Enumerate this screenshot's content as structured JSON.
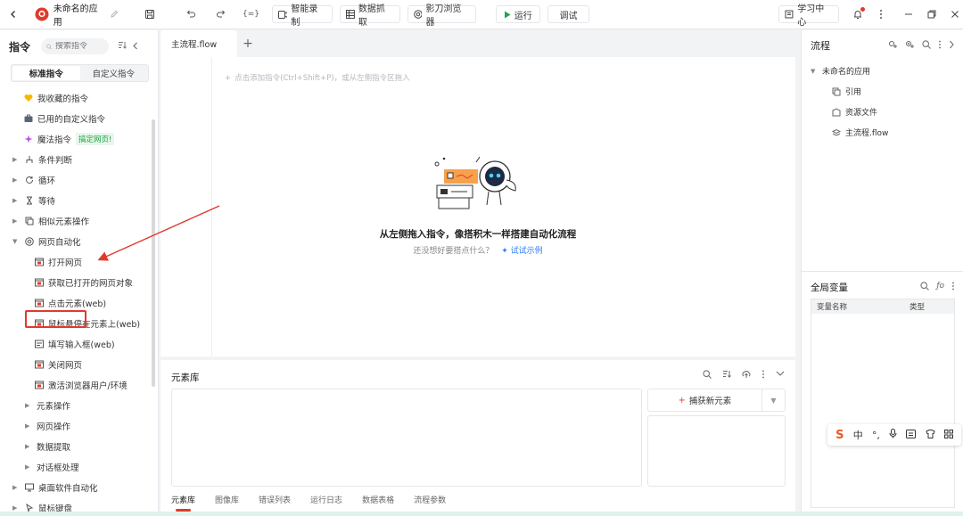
{
  "topbar": {
    "app_name": "未命名的应用",
    "buttons": {
      "variable": "{=}",
      "smart_record": "智能录制",
      "data_capture": "数据抓取",
      "browser": "影刀浏览器",
      "run": "运行",
      "debug": "调试",
      "learning_center": "学习中心"
    }
  },
  "left_panel": {
    "title": "指令",
    "search_placeholder": "搜索指令",
    "tabs": [
      "标准指令",
      "自定义指令"
    ],
    "favorites": "我收藏的指令",
    "used_custom": "已用的自定义指令",
    "magic": "魔法指令",
    "magic_badge": "搞定网页!",
    "items": [
      {
        "label": "条件判断"
      },
      {
        "label": "循环"
      },
      {
        "label": "等待"
      },
      {
        "label": "相似元素操作"
      },
      {
        "label": "网页自动化"
      }
    ],
    "web_items": [
      "打开网页",
      "获取已打开的网页对象",
      "点击元素(web)",
      "鼠标悬停在元素上(web)",
      "填写输入框(web)",
      "关闭网页",
      "激活浏览器用户/环境"
    ],
    "web_sub_groups": [
      "元素操作",
      "网页操作",
      "数据提取",
      "对话框处理"
    ],
    "bottom_items": [
      "桌面软件自动化",
      "鼠标键盘"
    ]
  },
  "editor": {
    "tab": "主流程.flow",
    "hint": "点击添加指令(Ctrl+Shift+P)，或从左侧指令区拖入",
    "empty_title": "从左侧拖入指令，像搭积木一样搭建自动化流程",
    "empty_sub": "还没想好要搭点什么？",
    "try_example": "试试示例"
  },
  "element_library": {
    "title": "元素库",
    "capture_button": "捕获新元素",
    "bottom_tabs": [
      "元素库",
      "图像库",
      "错误列表",
      "运行日志",
      "数据表格",
      "流程参数"
    ]
  },
  "right_panel": {
    "flow_title": "流程",
    "app_node": "未命名的应用",
    "tree": [
      "引用",
      "资源文件",
      "主流程.flow"
    ],
    "global_vars_title": "全局变量",
    "columns": [
      "变量名称",
      "类型"
    ]
  },
  "ime": {
    "logo": "S",
    "lang": "中"
  },
  "colors": {
    "accent_red": "#e03a2d",
    "run_green": "#22a546",
    "link_blue": "#2f7cf6"
  }
}
